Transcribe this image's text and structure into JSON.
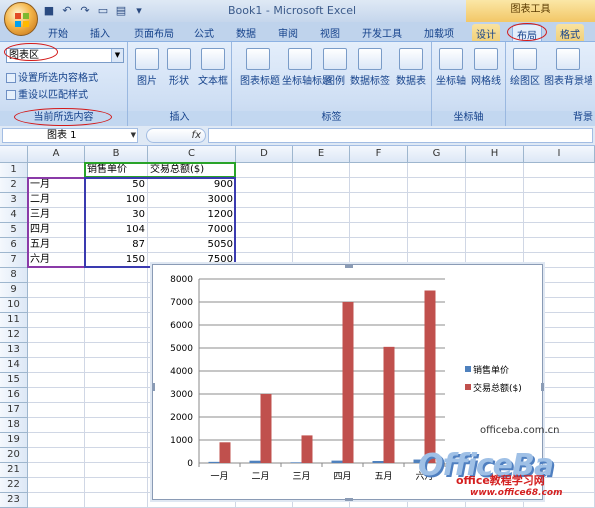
{
  "window": {
    "title": "Book1 - Microsoft Excel",
    "context_tools": "图表工具"
  },
  "tabs": [
    "开始",
    "插入",
    "页面布局",
    "公式",
    "数据",
    "审阅",
    "视图",
    "开发工具",
    "加载项",
    "设计",
    "布局",
    "格式"
  ],
  "active_tab": "布局",
  "ribbon": {
    "current_selection": {
      "dropdown_value": "图表区",
      "format_selection": "设置所选内容格式",
      "reset_style": "重设以匹配样式",
      "group_label": "当前所选内容"
    },
    "insert": {
      "buttons": [
        "图片",
        "形状",
        "文本框"
      ],
      "group_label": "插入"
    },
    "labels": {
      "buttons": [
        "图表标题",
        "坐标轴标题",
        "图例",
        "数据标签",
        "数据表"
      ],
      "group_label": "标签"
    },
    "axes": {
      "buttons": [
        "坐标轴",
        "网格线"
      ],
      "group_label": "坐标轴"
    },
    "background": {
      "buttons": [
        "绘图区",
        "图表背景墙"
      ],
      "group_label": "背景"
    }
  },
  "formula_bar": {
    "name_box": "图表 1",
    "fx": "fx",
    "value": ""
  },
  "columns": [
    "A",
    "B",
    "C",
    "D",
    "E",
    "F",
    "G",
    "H",
    "I"
  ],
  "rows": [
    "1",
    "2",
    "3",
    "4",
    "5",
    "6",
    "7",
    "8",
    "9",
    "10",
    "11",
    "12",
    "13",
    "14",
    "15",
    "16",
    "17",
    "18",
    "19",
    "20",
    "21",
    "22",
    "23"
  ],
  "sheet": {
    "headers": [
      "",
      "销售单价",
      "交易总额($)"
    ],
    "data": [
      [
        "一月",
        "50",
        "900"
      ],
      [
        "二月",
        "100",
        "3000"
      ],
      [
        "三月",
        "30",
        "1200"
      ],
      [
        "四月",
        "104",
        "7000"
      ],
      [
        "五月",
        "87",
        "5050"
      ],
      [
        "六月",
        "150",
        "7500"
      ]
    ]
  },
  "chart_data": {
    "type": "bar",
    "categories": [
      "一月",
      "二月",
      "三月",
      "四月",
      "五月",
      "六月"
    ],
    "series": [
      {
        "name": "销售单价",
        "values": [
          50,
          100,
          30,
          104,
          87,
          150
        ],
        "color": "#4f81bd"
      },
      {
        "name": "交易总额($)",
        "values": [
          900,
          3000,
          1200,
          7000,
          5050,
          7500
        ],
        "color": "#c0504d"
      }
    ],
    "ylim": [
      0,
      8000
    ],
    "yticks": [
      "0",
      "1000",
      "2000",
      "3000",
      "4000",
      "5000",
      "6000",
      "7000",
      "8000"
    ],
    "grid": true,
    "legend": "right"
  },
  "watermark": {
    "site1": "officeba.com.cn",
    "logo": "OfficeBa",
    "tagline": "office教程学习网",
    "site2": "www.office68.com"
  }
}
